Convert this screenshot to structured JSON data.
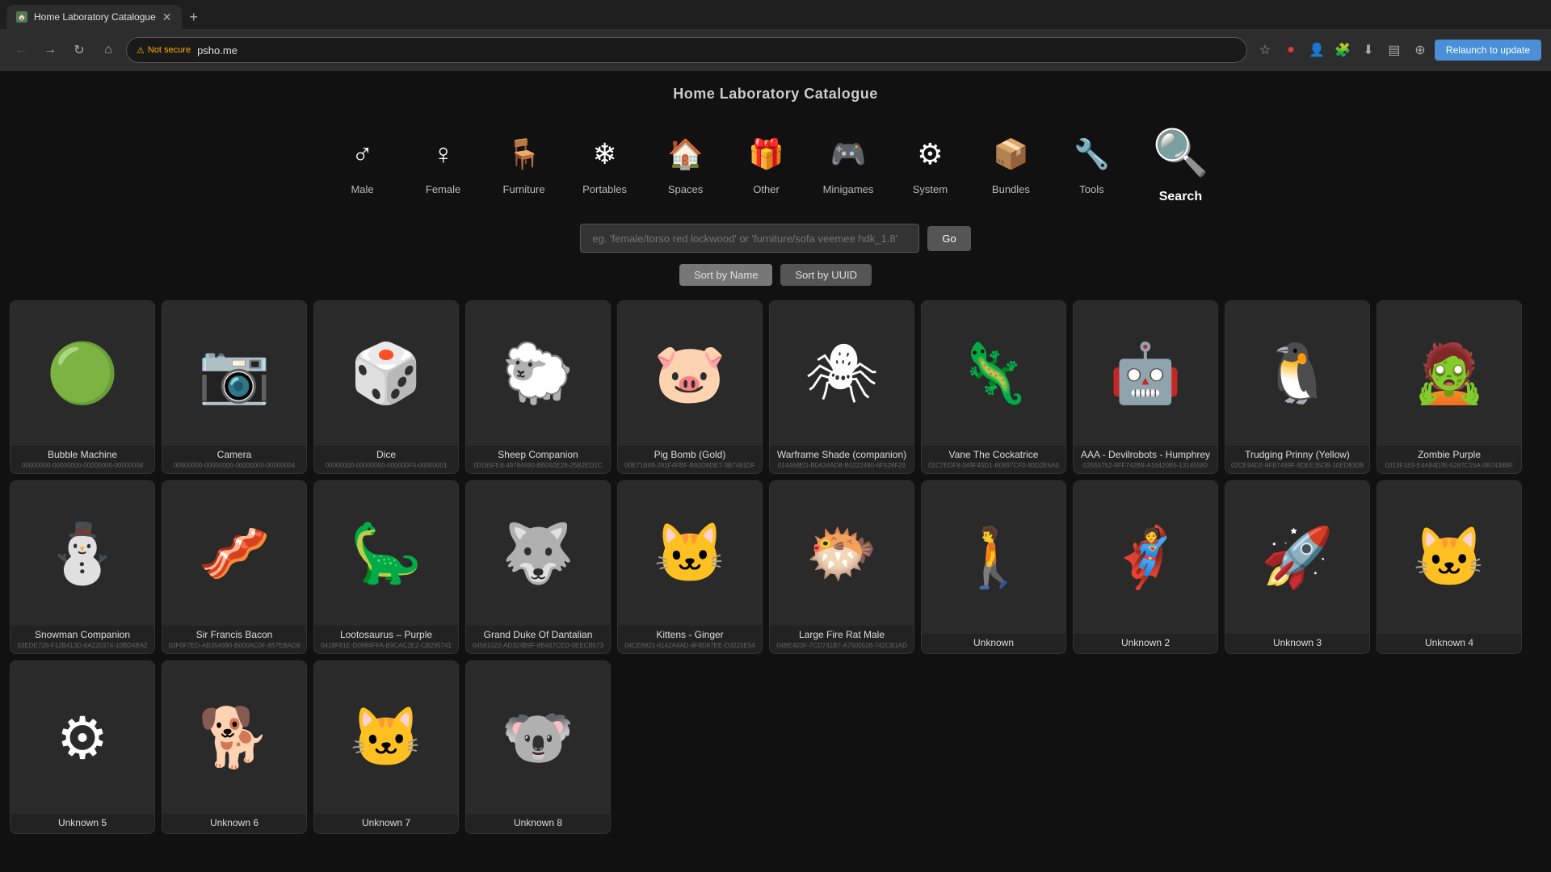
{
  "browser": {
    "tab_title": "Home Laboratory Catalogue",
    "tab_url": "psho.me",
    "not_secure_label": "Not secure",
    "relaunch_label": "Relaunch to update"
  },
  "page": {
    "title": "Home Laboratory Catalogue",
    "search_placeholder": "eg. 'female/torso red lockwood' or 'furniture/sofa veemee hdk_1.8'",
    "go_button": "Go",
    "sort_by_name": "Sort by Name",
    "sort_by_uuid": "Sort by UUID"
  },
  "categories": [
    {
      "id": "male",
      "label": "Male",
      "icon": "♂"
    },
    {
      "id": "female",
      "label": "Female",
      "icon": "♀"
    },
    {
      "id": "furniture",
      "label": "Furniture",
      "icon": "🪑"
    },
    {
      "id": "portables",
      "label": "Portables",
      "icon": "❄"
    },
    {
      "id": "spaces",
      "label": "Spaces",
      "icon": "🏠"
    },
    {
      "id": "other",
      "label": "Other",
      "icon": "🎁"
    },
    {
      "id": "minigames",
      "label": "Minigames",
      "icon": "🎮"
    },
    {
      "id": "system",
      "label": "System",
      "icon": "⚙"
    },
    {
      "id": "bundles",
      "label": "Bundles",
      "icon": "📦"
    },
    {
      "id": "tools",
      "label": "Tools",
      "icon": "🔧"
    },
    {
      "id": "search",
      "label": "Search",
      "icon": "🔍"
    }
  ],
  "items": [
    {
      "name": "Bubble Machine",
      "uuid": "00000000-00000000-00000000-00000008",
      "color": "#8bc34a",
      "emoji": "🟢"
    },
    {
      "name": "Camera",
      "uuid": "00000000-00000000-00000000-00000004",
      "color": "#555",
      "emoji": "📷"
    },
    {
      "name": "Dice",
      "uuid": "00000000-00000000-000000F0-00000001",
      "color": "#f5f0d0",
      "emoji": "🎲"
    },
    {
      "name": "Sheep Companion",
      "uuid": "00165FE8-49794590-BB092E28-25B2ED1C",
      "color": "#ccc",
      "emoji": "🐑"
    },
    {
      "name": "Pig Bomb (Gold)",
      "uuid": "00E71B89-291F4FBF-B80D8DE7-3B7481DF",
      "color": "#ffc107",
      "emoji": "🐷"
    },
    {
      "name": "Warframe Shade (companion)",
      "uuid": "014468ED-B0A34AD8-B0222480-6F528F29",
      "color": "#333",
      "emoji": "🕷"
    },
    {
      "name": "Vane The Cockatrice",
      "uuid": "01C7EDF8-349F45D1-B0897CF0-90D2E6A0",
      "color": "#8d5524",
      "emoji": "🦎"
    },
    {
      "name": "AAA - Devilrobots - Humphrey",
      "uuid": "02555752-9FF742B9-A16420B5-13145580",
      "color": "#e91e63",
      "emoji": "🤖"
    },
    {
      "name": "Trudging Prinny (Yellow)",
      "uuid": "02CE94D2-8FB7489F-8DEE35DB-10ED830B",
      "color": "#ffc107",
      "emoji": "🐧"
    },
    {
      "name": "Zombie Purple",
      "uuid": "0313F183-E4A84D35-5287C15A-0B7438BF",
      "color": "#9c27b0",
      "emoji": "🧟"
    },
    {
      "name": "Snowman Companion",
      "uuid": "03EDE728-F12B413D-8A220374-10BD4BA2",
      "color": "#e0e0e0",
      "emoji": "⛄"
    },
    {
      "name": "Sir Francis Bacon",
      "uuid": "03F0F7ED-AB354690-B000AC0F-857EBAD9",
      "color": "#d2691e",
      "emoji": "🥓"
    },
    {
      "name": "Lootosaurus – Purple",
      "uuid": "0418F81E-D0894FFA-B9CAC2E2-CB295741",
      "color": "#9c27b0",
      "emoji": "🦕"
    },
    {
      "name": "Grand Duke Of Dantalian",
      "uuid": "04581022-AD324B9F-8B467CED-0EECB573",
      "color": "#888",
      "emoji": "🐺"
    },
    {
      "name": "Kittens - Ginger",
      "uuid": "04CE6921-6142A4AD-9F8D97EE-D3223E54",
      "color": "#ff9800",
      "emoji": "🐱"
    },
    {
      "name": "Large Fire Rat Male",
      "uuid": "04BE403F-7CD741B7-A7500528-742CB1AD",
      "color": "#f44336",
      "emoji": "🐡"
    },
    {
      "name": "Unknown",
      "uuid": "",
      "color": "#222",
      "emoji": "🚶"
    },
    {
      "name": "Unknown 2",
      "uuid": "",
      "color": "#c00",
      "emoji": "🦸"
    },
    {
      "name": "Unknown 3",
      "uuid": "",
      "color": "#333",
      "emoji": "🚀"
    },
    {
      "name": "Unknown 4",
      "uuid": "",
      "color": "#888",
      "emoji": "🐱"
    },
    {
      "name": "Unknown 5",
      "uuid": "",
      "color": "#ffc107",
      "emoji": "⚙"
    },
    {
      "name": "Unknown 6",
      "uuid": "",
      "color": "#555",
      "emoji": "🐕"
    },
    {
      "name": "Unknown 7",
      "uuid": "",
      "color": "#ff9800",
      "emoji": "🐱"
    },
    {
      "name": "Unknown 8",
      "uuid": "",
      "color": "#888",
      "emoji": "🐨"
    }
  ]
}
